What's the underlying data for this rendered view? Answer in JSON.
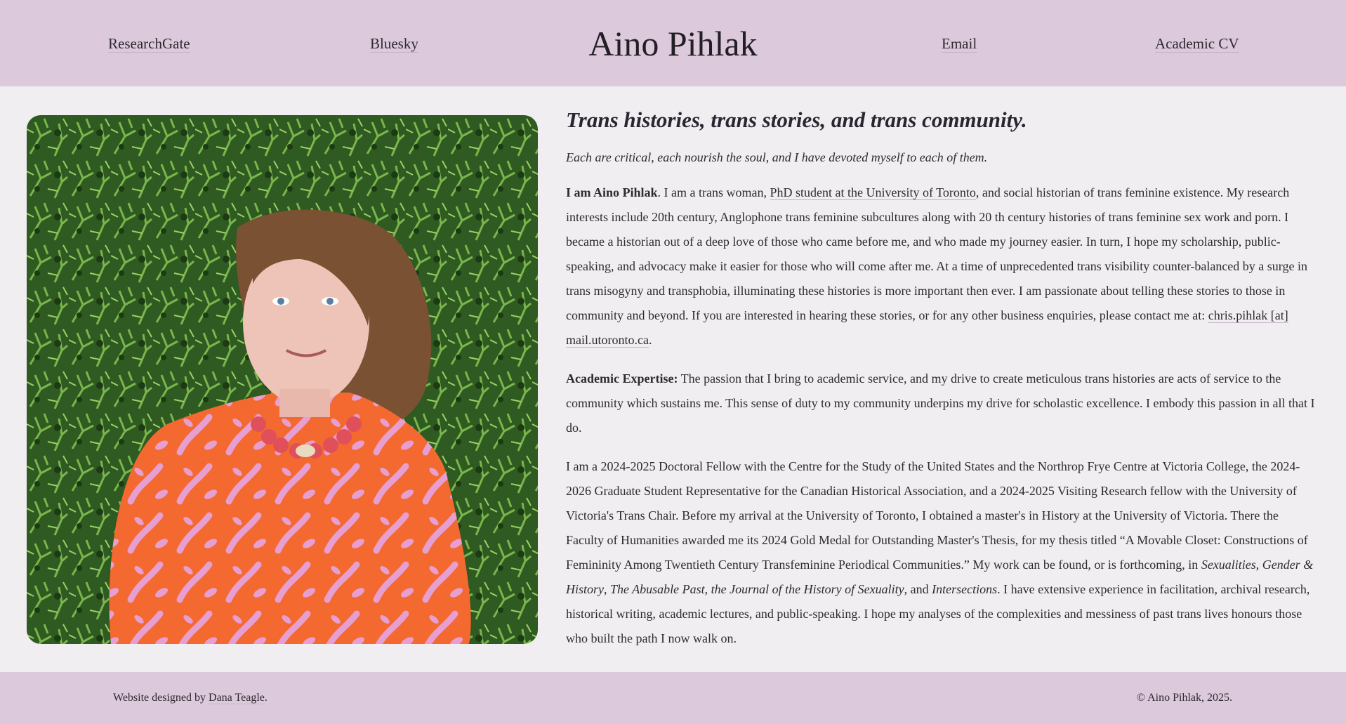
{
  "nav": {
    "researchgate": "ResearchGate",
    "bluesky": "Bluesky",
    "site_title": "Aino Pihlak",
    "email": "Email",
    "academic_cv": "Academic CV"
  },
  "main": {
    "headline": "Trans histories, trans stories, and trans community.",
    "tagline": "Each are critical, each nourish the soul, and I have devoted myself to each of them.",
    "intro": {
      "lead_bold": "I am Aino Pihlak",
      "text_1": ". I am a trans woman, ",
      "link_phd": "PhD student at the University of Toronto",
      "text_2": ", and social historian of trans feminine existence. My research interests include 20th century, Anglophone trans feminine subcultures along with 20 th century histories of trans feminine sex work and porn. I became a historian out of a deep love of those who came before me, and who made my journey easier. In turn, I hope my scholarship, public-speaking, and advocacy make it easier for those who will come after me. At a time of unprecedented trans visibility counter-balanced by a surge in trans misogyny and transphobia, illuminating these histories is more important then ever. I am passionate about telling these stories to those in community and beyond. If you are interested in hearing these stories, or for any other business enquiries, please contact me at: ",
      "link_email": "chris.pihlak [at] mail.utoronto.ca",
      "text_3": "."
    },
    "expertise": {
      "lead_bold": "Academic Expertise:",
      "text": " The passion that I bring to academic service, and my drive to create meticulous trans histories are acts of service to the community which sustains me. This sense of duty to my community underpins my drive for scholastic excellence. I embody this passion in all that I do."
    },
    "fellowship": {
      "text_1": "I am a 2024-2025 Doctoral Fellow with the Centre for the Study of the United States and the Northrop Frye Centre at Victoria College, the 2024-2026 Graduate Student Representative for the Canadian Historical Association, and a 2024-2025 Visiting Research fellow with the University of Victoria's Trans Chair. Before my arrival at the University of Toronto, I obtained a master's in History at the University of Victoria. There the Faculty of Humanities awarded me its 2024 Gold Medal for Outstanding Master's Thesis, for my thesis titled “A Movable Closet: Constructions of Femininity Among Twentieth Century Transfeminine Periodical Communities.” My work can be found, or is forthcoming, in ",
      "journal_1": "Sexualities",
      "sep_1": ", ",
      "journal_2": "Gender & History",
      "sep_2": ", ",
      "journal_3": "The Abusable Past",
      "sep_3": ", ",
      "journal_4": "the Journal of the History of Sexuality",
      "sep_4": ", and ",
      "journal_5": "Intersections",
      "text_2": ". I have extensive experience in facilitation, archival research, historical writing, academic lectures, and public-speaking. I hope my analyses of the complexities and messiness of past trans lives honours those who built the path I now walk on."
    }
  },
  "footer": {
    "credit_prefix": "Website designed by ",
    "credit_link": "Dana Teagle",
    "credit_suffix": ".",
    "copyright": "© Aino Pihlak, 2025."
  },
  "colors": {
    "header_bg": "#dcc9dc",
    "page_bg": "#f1eef1",
    "text": "#2e2a2f"
  }
}
